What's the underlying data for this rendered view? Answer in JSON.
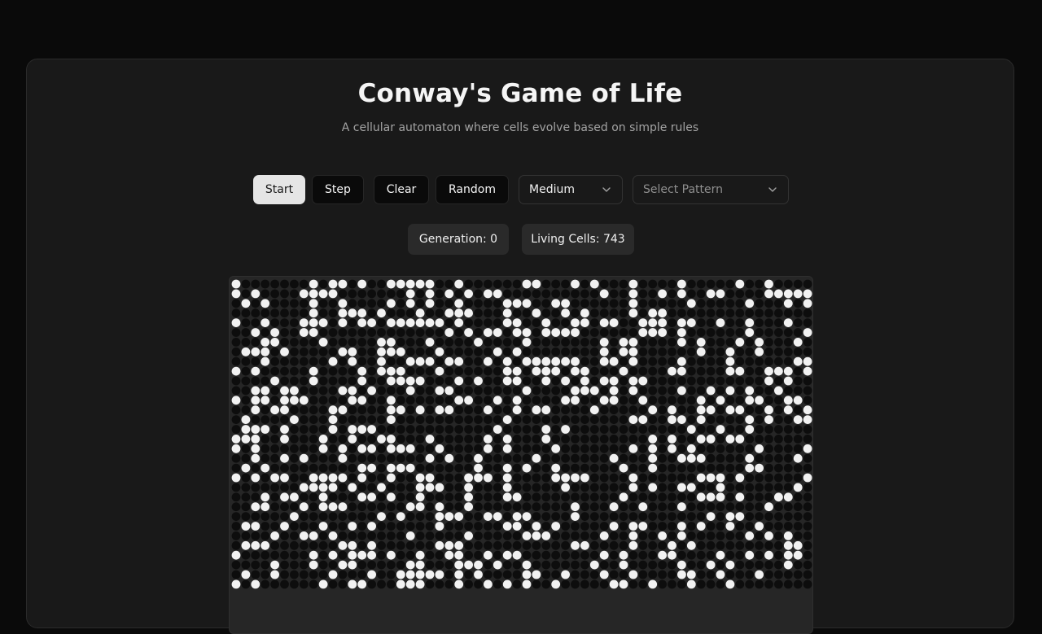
{
  "header": {
    "title": "Conway's Game of Life",
    "subtitle": "A cellular automaton where cells evolve based on simple rules"
  },
  "controls": {
    "start_label": "Start",
    "step_label": "Step",
    "clear_label": "Clear",
    "random_label": "Random",
    "speed_select": {
      "value": "Medium"
    },
    "pattern_select": {
      "placeholder": "Select Pattern"
    }
  },
  "stats": {
    "generation_text": "Generation: 0",
    "living_cells_text": "Living Cells: 743"
  },
  "grid": {
    "columns": 60,
    "visible_rows": 32,
    "alive_density": 0.33,
    "colors": {
      "alive": "#f2f2f2",
      "dead": "#0d0d0d",
      "background": "#262626"
    }
  },
  "colors": {
    "page_background": "#0a0a0a",
    "card_background": "#191919",
    "primary_button": "#e5e5e5",
    "secondary_button": "#0a0a0a",
    "stat_badge": "#2a2a2a",
    "muted_text": "#a3a3a3"
  }
}
